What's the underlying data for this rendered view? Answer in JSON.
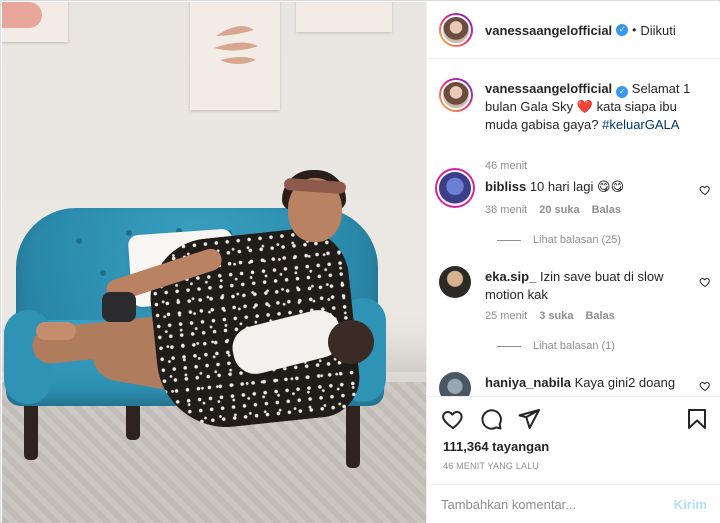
{
  "post": {
    "username": "vanessaangelofficial",
    "separator": "•",
    "follow_status": "Diikuti",
    "caption_text": "Selamat 1 bulan Gala Sky",
    "caption_emoji": "❤️",
    "caption_rest": "kata siapa ibu muda gabisa gaya?",
    "caption_hashtag": "#keluarGALA",
    "caption_time": "46 menit"
  },
  "comments": [
    {
      "username": "bibliss",
      "text": "10 hari lagi 😋😋",
      "time": "38 menit",
      "likes": "20 suka",
      "reply": "Balas",
      "view_replies": "Lihat balasan (25)"
    },
    {
      "username": "eka.sip_",
      "text": "Izin save buat di slow motion kak",
      "time": "25 menit",
      "likes": "3 suka",
      "reply": "Balas",
      "view_replies": "Lihat balasan (1)"
    },
    {
      "username": "haniya_nabila",
      "text": "Kaya gini2 doang"
    }
  ],
  "stats": {
    "views": "111,364 tayangan",
    "time_ago": "46 MENIT YANG LALU"
  },
  "comment_box": {
    "placeholder": "Tambahkan komentar...",
    "post_label": "Kirim"
  },
  "icons": {
    "like": "heart-icon",
    "comment": "comment-icon",
    "share": "paper-plane-icon",
    "save": "bookmark-icon",
    "verified": "verified-badge-icon"
  },
  "colors": {
    "verified": "#3897f0",
    "hashtag": "#00376b",
    "muted": "#8e8e8e",
    "post_button_disabled": "#b2dffc",
    "heart": "#ed4956"
  }
}
